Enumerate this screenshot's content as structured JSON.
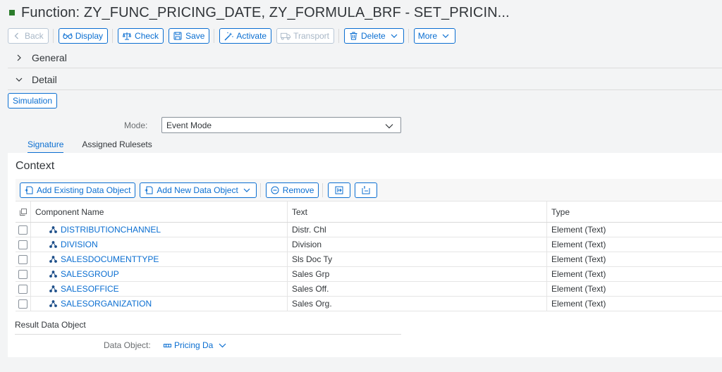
{
  "title": "Function: ZY_FUNC_PRICING_DATE, ZY_FORMULA_BRF - SET_PRICIN...",
  "toolbar": {
    "back": "Back",
    "display": "Display",
    "check": "Check",
    "save": "Save",
    "activate": "Activate",
    "transport": "Transport",
    "delete": "Delete",
    "more": "More"
  },
  "sections": {
    "general": "General",
    "detail": "Detail"
  },
  "simulation": "Simulation",
  "mode": {
    "label": "Mode:",
    "value": "Event Mode"
  },
  "tabs": [
    "Signature",
    "Assigned Rulesets"
  ],
  "context": {
    "title": "Context",
    "buttons": {
      "add_existing": "Add Existing Data Object",
      "add_new": "Add New Data Object",
      "remove": "Remove"
    },
    "columns": [
      "Component Name",
      "Text",
      "Type"
    ],
    "rows": [
      {
        "name": "DISTRIBUTIONCHANNEL",
        "text": "Distr. Chl",
        "type": "Element (Text)"
      },
      {
        "name": "DIVISION",
        "text": "Division",
        "type": "Element (Text)"
      },
      {
        "name": "SALESDOCUMENTTYPE",
        "text": "Sls Doc Ty",
        "type": "Element (Text)"
      },
      {
        "name": "SALESGROUP",
        "text": "Sales Grp",
        "type": "Element (Text)"
      },
      {
        "name": "SALESOFFICE",
        "text": "Sales Off.",
        "type": "Element (Text)"
      },
      {
        "name": "SALESORGANIZATION",
        "text": "Sales Org.",
        "type": "Element (Text)"
      }
    ]
  },
  "result": {
    "label": "Result Data Object",
    "data_object_label": "Data Object:",
    "data_object_value": "Pricing Da"
  }
}
